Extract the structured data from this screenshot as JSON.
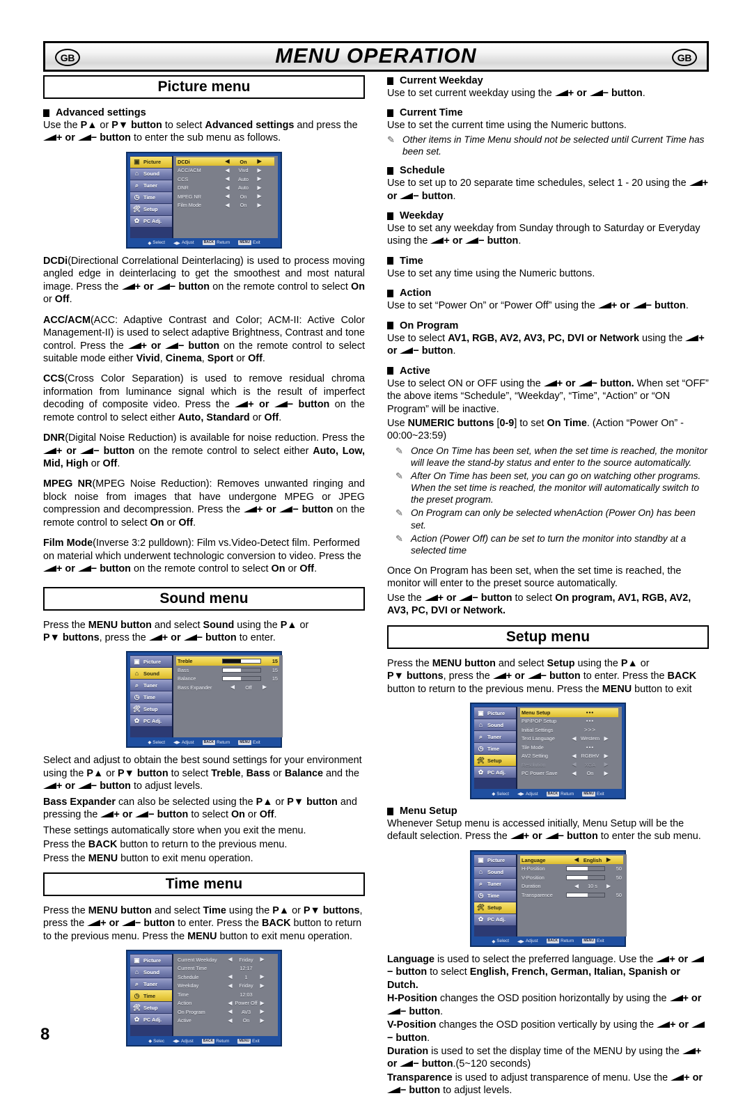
{
  "header": {
    "title": "MENU OPERATION",
    "badge_left": "GB",
    "badge_right": "GB"
  },
  "page_number": "8",
  "left": {
    "picture_menu": {
      "title": "Picture menu",
      "advanced_heading": "Advanced settings",
      "advanced_intro_1": "Use the ",
      "advanced_intro_pkey_a": "P▲",
      "advanced_intro_or": " or ",
      "advanced_intro_pkey_b": "P▼ button",
      "advanced_intro_2": " to select ",
      "advanced_intro_bold": "Advanced settings",
      "advanced_intro_3": " and press the ",
      "advanced_intro_4": "+  or ",
      "advanced_intro_5": "− button",
      "advanced_intro_6": " to enter the sub menu as follows.",
      "osd": {
        "sidebar": [
          "Picture",
          "Sound",
          "Tuner",
          "Time",
          "Setup",
          "PC Adj."
        ],
        "selected_sidebar": "Picture",
        "rows": [
          {
            "label": "DCDi",
            "value": "On",
            "selected": true
          },
          {
            "label": "ACC/ACM",
            "value": "Vivd",
            "selected": false
          },
          {
            "label": "CCS",
            "value": "Auto",
            "selected": false
          },
          {
            "label": "DNR",
            "value": "Auto",
            "selected": false
          },
          {
            "label": "MPEG NR",
            "value": "On",
            "selected": false
          },
          {
            "label": "Film Mode",
            "value": "On",
            "selected": false
          }
        ],
        "footer": [
          "Select",
          "Adjust",
          "Return",
          "Exit"
        ],
        "footer_keys": [
          "BACK",
          "MENU"
        ]
      },
      "dcdi": {
        "bold": "DCDi",
        "text_a": "(Directional Correlational Deinterlacing) is used to process moving angled edge in deinterlacing to get the smoothest and most natural image. Press the ",
        "text_b": "+  or ",
        "text_c": "− button",
        "text_d": " on the remote control to select ",
        "opt1": "On",
        "mid": " or ",
        "opt2": "Off",
        "end": "."
      },
      "accacm": {
        "bold": "ACC/ACM",
        "text_a": "(ACC: Adaptive Contrast and Color; ACM-II: Active Color Management-II) is used to select adaptive Brightness, Contrast and tone control. Press the ",
        "text_b": "+  or ",
        "text_c": "− button",
        "text_d": " on the remote control to select suitable mode either ",
        "opt1": "Vivid",
        "sep1": ", ",
        "opt2": "Cinema",
        "sep2": ", ",
        "opt3": "Sport",
        "sep3": " or ",
        "opt4": "Off",
        "end": "."
      },
      "ccs": {
        "bold": "CCS",
        "text_a": "(Cross Color Separation) is used to remove residual chroma information from luminance signal which is the result of imperfect decoding of composite video. Press the ",
        "text_b": "+  or ",
        "text_c": "− button",
        "text_d": " on the remote    control to select either ",
        "opt1": "Auto, Standard",
        "sep1": " or ",
        "opt2": "Off",
        "end": "."
      },
      "dnr": {
        "bold": "DNR",
        "text_a": "(Digital Noise Reduction) is available for noise reduction. Press the ",
        "text_b": "+  or ",
        "text_c": "− button",
        "text_d": " on the remote control to select either ",
        "opt1": "Auto, Low, Mid, High",
        "sep1": " or ",
        "opt2": "Off",
        "end": "."
      },
      "mpegnr": {
        "bold": "MPEG NR",
        "text_a": "(MPEG Noise Reduction): Removes unwanted ringing and block noise from images that have undergone MPEG or JPEG compression and decompression. Press the ",
        "text_b": "+  or ",
        "text_c": "− button",
        "text_d": " on the remote control to select ",
        "opt1": "On",
        "sep1": " or ",
        "opt2": "Off",
        "end": "."
      },
      "filmmode": {
        "bold": "Film Mode",
        "text_a": "(Inverse 3:2 pulldown): Film vs.Video-Detect film. Performed on material which underwent technologic conversion to video. Press the ",
        "text_b": "+  or ",
        "text_c": "− button",
        "text_d": " on the remote control to select ",
        "opt1": "On",
        "sep1": " or ",
        "opt2": "Off",
        "end": "."
      }
    },
    "sound_menu": {
      "title": "Sound menu",
      "intro_a": "Press the ",
      "intro_menu": "MENU button",
      "intro_b": " and select ",
      "intro_sound": "Sound",
      "intro_c": " using the ",
      "intro_pa": "P▲",
      "intro_d": " or ",
      "intro_pb": "P▼ buttons",
      "intro_e": ", press the ",
      "intro_f": "+  or ",
      "intro_g": "− button",
      "intro_h": " to enter.",
      "osd": {
        "sidebar": [
          "Picture",
          "Sound",
          "Tuner",
          "Time",
          "Setup",
          "PC Adj."
        ],
        "selected_sidebar": "Sound",
        "rows": [
          {
            "label": "Treble",
            "type": "bar",
            "value": "15",
            "fill": 48,
            "selected": true
          },
          {
            "label": "Bass",
            "type": "bar",
            "value": "15",
            "fill": 48,
            "selected": false
          },
          {
            "label": "Balance",
            "type": "bar",
            "value": "15",
            "fill": 48,
            "selected": false
          },
          {
            "label": "Bass Expander",
            "type": "arrows",
            "value": "Off",
            "selected": false
          }
        ],
        "footer": [
          "Select",
          "Adjust",
          "Return",
          "Exit"
        ],
        "footer_keys": [
          "BACK",
          "MENU"
        ]
      },
      "body": {
        "a": "Select and adjust to obtain the best sound settings for your environment using the ",
        "pa": "P▲",
        "b": " or ",
        "pb": "P▼ button",
        "c": " to select ",
        "t1": "Treble",
        "c2": ", ",
        "t2": "Bass",
        "c3": " or ",
        "t3": "Balance",
        "c4": " and the ",
        "v1": "+  or ",
        "v2": "− button",
        "c5": " to adjust levels.",
        "d1": "Bass Expander",
        "d2": " can also be selected using the ",
        "d3": "P▲",
        "d4": " or ",
        "d5": "P▼ button",
        "d6": " and pressing the ",
        "d7": "+  or ",
        "d8": "− button",
        "d9": " to select ",
        "d10": "On",
        "d11": " or ",
        "d12": "Off",
        "d13": ".",
        "e": "These settings automatically store when you exit the menu.",
        "f1": "Press the ",
        "f2": "BACK",
        "f3": " button to return to the previous menu.",
        "g1": "Press the ",
        "g2": "MENU",
        "g3": " button to exit menu operation."
      }
    },
    "time_menu": {
      "title": "Time menu",
      "intro": {
        "a": "Press the ",
        "menu": "MENU button",
        "b": " and select ",
        "time": "Time",
        "c": " using the ",
        "pa": "P▲",
        "d": " or ",
        "pb": "P▼ buttons",
        "e": ", press the ",
        "v1": "+  or ",
        "v2": "− button",
        "f": " to enter. Press the ",
        "back": "BACK",
        "g": " button to return to the previous menu. Press the ",
        "menu2": "MENU",
        "h": " button to exit menu operation."
      },
      "osd": {
        "sidebar": [
          "Picture",
          "Sound",
          "Tuner",
          "Time",
          "Setup",
          "PC Adj."
        ],
        "selected_sidebar": "Time",
        "rows": [
          {
            "label": "Current Weekday",
            "value": "Friday",
            "arrows": true
          },
          {
            "label": "Current Time",
            "value": "12:17",
            "arrows": false
          },
          {
            "label": "Schedule",
            "value": "1",
            "arrows": true
          },
          {
            "label": "Weekday",
            "value": "Friday",
            "arrows": true
          },
          {
            "label": "Time",
            "value": "12:03",
            "arrows": false
          },
          {
            "label": "Action",
            "value": "Power Off",
            "arrows": true
          },
          {
            "label": "On Program",
            "value": "AV3",
            "arrows": true
          },
          {
            "label": "Active",
            "value": "On",
            "arrows": true
          }
        ],
        "footer": [
          "Selec",
          "Adjust",
          "Return",
          "Exit"
        ],
        "footer_keys": [
          "BACK",
          "MENU"
        ]
      }
    }
  },
  "right": {
    "time_items": [
      {
        "heading": "Current Weekday",
        "a": "Use to set current weekday using the ",
        "v1": "+  or ",
        "v2": "− button",
        "b": "."
      },
      {
        "heading": "Current Time",
        "a": "Use to set the current time using the Numeric buttons.",
        "note": "Other items in Time Menu should not be selected until Current Time has been set."
      },
      {
        "heading": "Schedule",
        "a": "Use to set up to 20 separate time schedules, select 1 - 20 using the ",
        "v1": "+  or ",
        "v2": "− button",
        "b": "."
      },
      {
        "heading": "Weekday",
        "a": "Use to set any weekday from Sunday through to Saturday or Everyday using the ",
        "v1": "+  or ",
        "v2": "− button",
        "b": "."
      },
      {
        "heading": "Time",
        "a": "Use to set any time using the Numeric buttons."
      },
      {
        "heading": "Action",
        "a": "Use to set “Power On” or “Power Off” using the ",
        "v1": "+  or ",
        "v2": "− button",
        "b": "."
      },
      {
        "heading": "On Program",
        "a": "Use to select ",
        "bold": "AV1, RGB, AV2, AV3, PC, DVI or Network",
        "a2": " using the ",
        "v1": "+  or ",
        "v2": "− button",
        "b": "."
      }
    ],
    "active": {
      "heading": "Active",
      "a": "Use to select ON or OFF using the ",
      "v1": "+  or ",
      "v2": "− button.",
      "b": " When set “OFF” the above items “Schedule”, “Weekday”, “Time”, “Action” or “ON Program” will be inactive.",
      "c1": "Use ",
      "c2": "NUMERIC buttons",
      "c3": " [",
      "c4": "0-9",
      "c5": "] to set ",
      "c6": "On Time",
      "c7": ". (Action “Power On” - 00:00~23:59)",
      "notes": [
        "Once On Time has been set, when the set time is reached, the monitor will leave the stand-by status and enter to the source automatically.",
        "After On Time has been set, you can go on watching other programs. When the set time is reached, the monitor will automatically switch to the preset program.",
        "On Program can only be selected whenAction (Power On) has been set.",
        "Action (Power Off) can be set to turn the monitor into standby at a selected time"
      ],
      "tail_a": "Once On Program has been set, when the set time is reached, the monitor will enter to the preset source automatically.",
      "tail_b1": "Use the ",
      "tail_v1": "+  or ",
      "tail_v2": "− button",
      "tail_b2": " to select ",
      "tail_bold": "On program, AV1, RGB, AV2, AV3, PC, DVI or Network."
    },
    "setup_menu": {
      "title": "Setup menu",
      "intro": {
        "a": "Press the ",
        "menu": "MENU button",
        "b": " and select ",
        "setup": "Setup",
        "c": " using the ",
        "pa": "P▲",
        "d": " or ",
        "pb": "P▼ buttons",
        "e": ", press the ",
        "v1": "+  or ",
        "v2": "− button",
        "f": " to enter. Press the ",
        "back": "BACK",
        "g": " button to return to the previous menu. Press the ",
        "menu2": "MENU",
        "h": " button to exit"
      },
      "osd1": {
        "sidebar": [
          "Picture",
          "Sound",
          "Tuner",
          "Time",
          "Setup",
          "PC Adj."
        ],
        "selected_sidebar": "Setup",
        "rows": [
          {
            "label": "Menu Setup",
            "value": "•••",
            "type": "dots",
            "selected": true
          },
          {
            "label": "PIP/POP Setup",
            "value": "•••",
            "type": "dots",
            "selected": false
          },
          {
            "label": "Initial Settings",
            "value": ">>>",
            "type": "dots",
            "selected": false
          },
          {
            "label": "Text Language",
            "value": "Western",
            "type": "arrows",
            "selected": false
          },
          {
            "label": "Tile Mode",
            "value": "•••",
            "type": "dots",
            "selected": false
          },
          {
            "label": "AV2 Setting",
            "value": "RGBHV",
            "type": "arrows",
            "selected": false
          },
          {
            "label": "Resolution",
            "value": "XGA",
            "type": "arrows",
            "selected": false,
            "dim": true
          },
          {
            "label": "PC Power Save",
            "value": "On",
            "type": "arrows",
            "selected": false
          }
        ],
        "footer": [
          "Select",
          "Adjust",
          "Return",
          "Exit"
        ],
        "footer_keys": [
          "BACK",
          "MENU"
        ]
      },
      "menu_setup": {
        "heading": "Menu Setup",
        "a": "Whenever Setup menu is accessed initially, Menu Setup will be the default selection. Press the ",
        "v1": "+  or ",
        "v2": "− button",
        "b": " to enter the sub menu."
      },
      "osd2": {
        "sidebar": [
          "Picture",
          "Sound",
          "Tuner",
          "Time",
          "Setup",
          "PC Adj."
        ],
        "selected_sidebar": "Setup",
        "rows": [
          {
            "label": "Language",
            "value": "English",
            "type": "arrows",
            "selected": true
          },
          {
            "label": "H-Position",
            "value": "50",
            "type": "bar",
            "fill": 55,
            "selected": false
          },
          {
            "label": "V-Position",
            "value": "50",
            "type": "bar",
            "fill": 55,
            "selected": false
          },
          {
            "label": "Duration",
            "value": "10 s",
            "type": "arrows",
            "selected": false
          },
          {
            "label": "Transparence",
            "value": "50",
            "type": "bar",
            "fill": 55,
            "selected": false
          }
        ],
        "footer": [
          "Select",
          "Adjust",
          "Return",
          "Exit"
        ],
        "footer_keys": [
          "BACK",
          "MENU"
        ]
      },
      "descriptions": {
        "lang_b": "Language",
        "lang_a": " is used to select the preferred language. Use the ",
        "lang_v1": "+ or ",
        "lang_v2": "− button",
        "lang_a2": " to select ",
        "lang_opts": "English, French, German, Italian, Spanish or Dutch.",
        "hpos_b": "H-Position",
        "hpos_a": " changes the OSD position horizontally by using the ",
        "hpos_v1": "+ or ",
        "hpos_v2": "− button",
        "hpos_a2": ".",
        "vpos_b": "V-Position",
        "vpos_a": " changes the OSD position vertically by using the ",
        "vpos_v1": "+ or ",
        "vpos_v2": "− button",
        "vpos_a2": ".",
        "dur_b": "Duration",
        "dur_a": " is used to set the display time of the MENU by using the ",
        "dur_v1": "+  or ",
        "dur_v2": "− button",
        "dur_a2": ".(5~120 seconds)",
        "tr_b": "Transparence",
        "tr_a": " is used to adjust transparence of menu. Use the ",
        "tr_v1": "+ or ",
        "tr_v2": "− button",
        "tr_a2": " to adjust levels."
      }
    }
  }
}
